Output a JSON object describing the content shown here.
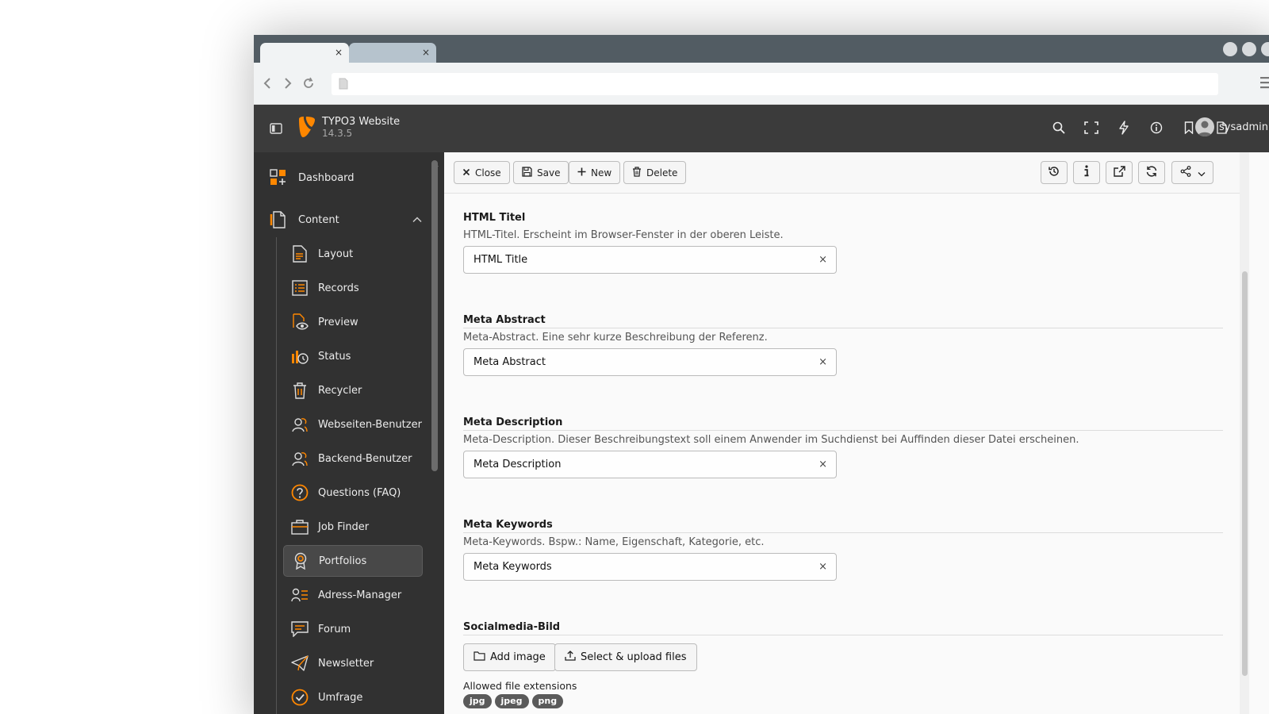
{
  "browser": {
    "tabs": [
      {
        "label": "",
        "close": "×"
      },
      {
        "label": "",
        "close": "×"
      }
    ],
    "url": ""
  },
  "topbar": {
    "site_name": "TYPO3 Website",
    "version": "14.3.5",
    "user": "sysadmin",
    "icons": [
      "search-icon",
      "fullscreen-icon",
      "flash-icon",
      "info-icon",
      "bookmark-icon",
      "document-icon"
    ]
  },
  "sidebar": {
    "dashboard": "Dashboard",
    "content": "Content",
    "items": [
      {
        "label": "Layout",
        "icon": "layout-icon"
      },
      {
        "label": "Records",
        "icon": "records-icon"
      },
      {
        "label": "Preview",
        "icon": "preview-icon"
      },
      {
        "label": "Status",
        "icon": "status-icon"
      },
      {
        "label": "Recycler",
        "icon": "recycler-icon"
      },
      {
        "label": "Webseiten-Benutzer",
        "icon": "website-users-icon"
      },
      {
        "label": "Backend-Benutzer",
        "icon": "backend-users-icon"
      },
      {
        "label": "Questions (FAQ)",
        "icon": "faq-icon"
      },
      {
        "label": "Job Finder",
        "icon": "briefcase-icon"
      },
      {
        "label": "Portfolios",
        "icon": "portfolio-icon",
        "active": true
      },
      {
        "label": "Adress-Manager",
        "icon": "address-icon"
      },
      {
        "label": "Forum",
        "icon": "forum-icon"
      },
      {
        "label": "Newsletter",
        "icon": "newsletter-icon"
      },
      {
        "label": "Umfrage",
        "icon": "survey-icon"
      }
    ]
  },
  "docheader": {
    "close": "Close",
    "save": "Save",
    "new": "New",
    "delete": "Delete"
  },
  "form": {
    "fields": [
      {
        "label": "HTML Titel",
        "desc": "HTML-Titel. Erscheint im Browser-Fenster in der oberen Leiste.",
        "value": "HTML Title"
      },
      {
        "label": "Meta Abstract",
        "desc": "Meta-Abstract. Eine sehr kurze Beschreibung der Referenz.",
        "value": "Meta Abstract"
      },
      {
        "label": "Meta Description",
        "desc": "Meta-Description. Dieser Beschreibungstext soll einem Anwender im Suchdienst bei Auffinden dieser Datei erscheinen.",
        "value": "Meta Description"
      },
      {
        "label": "Meta Keywords",
        "desc": "Meta-Keywords. Bspw.: Name, Eigenschaft, Kategorie, etc.",
        "value": "Meta Keywords"
      }
    ],
    "clear": "×",
    "social": {
      "label": "Socialmedia-Bild",
      "add_image": "Add image",
      "upload": "Select & upload files",
      "allowed": "Allowed file extensions",
      "extensions": [
        "jpg",
        "jpeg",
        "png"
      ]
    }
  },
  "colors": {
    "accent": "#ff8700",
    "topbar": "#3b3b3b",
    "sidebar": "#313131"
  }
}
